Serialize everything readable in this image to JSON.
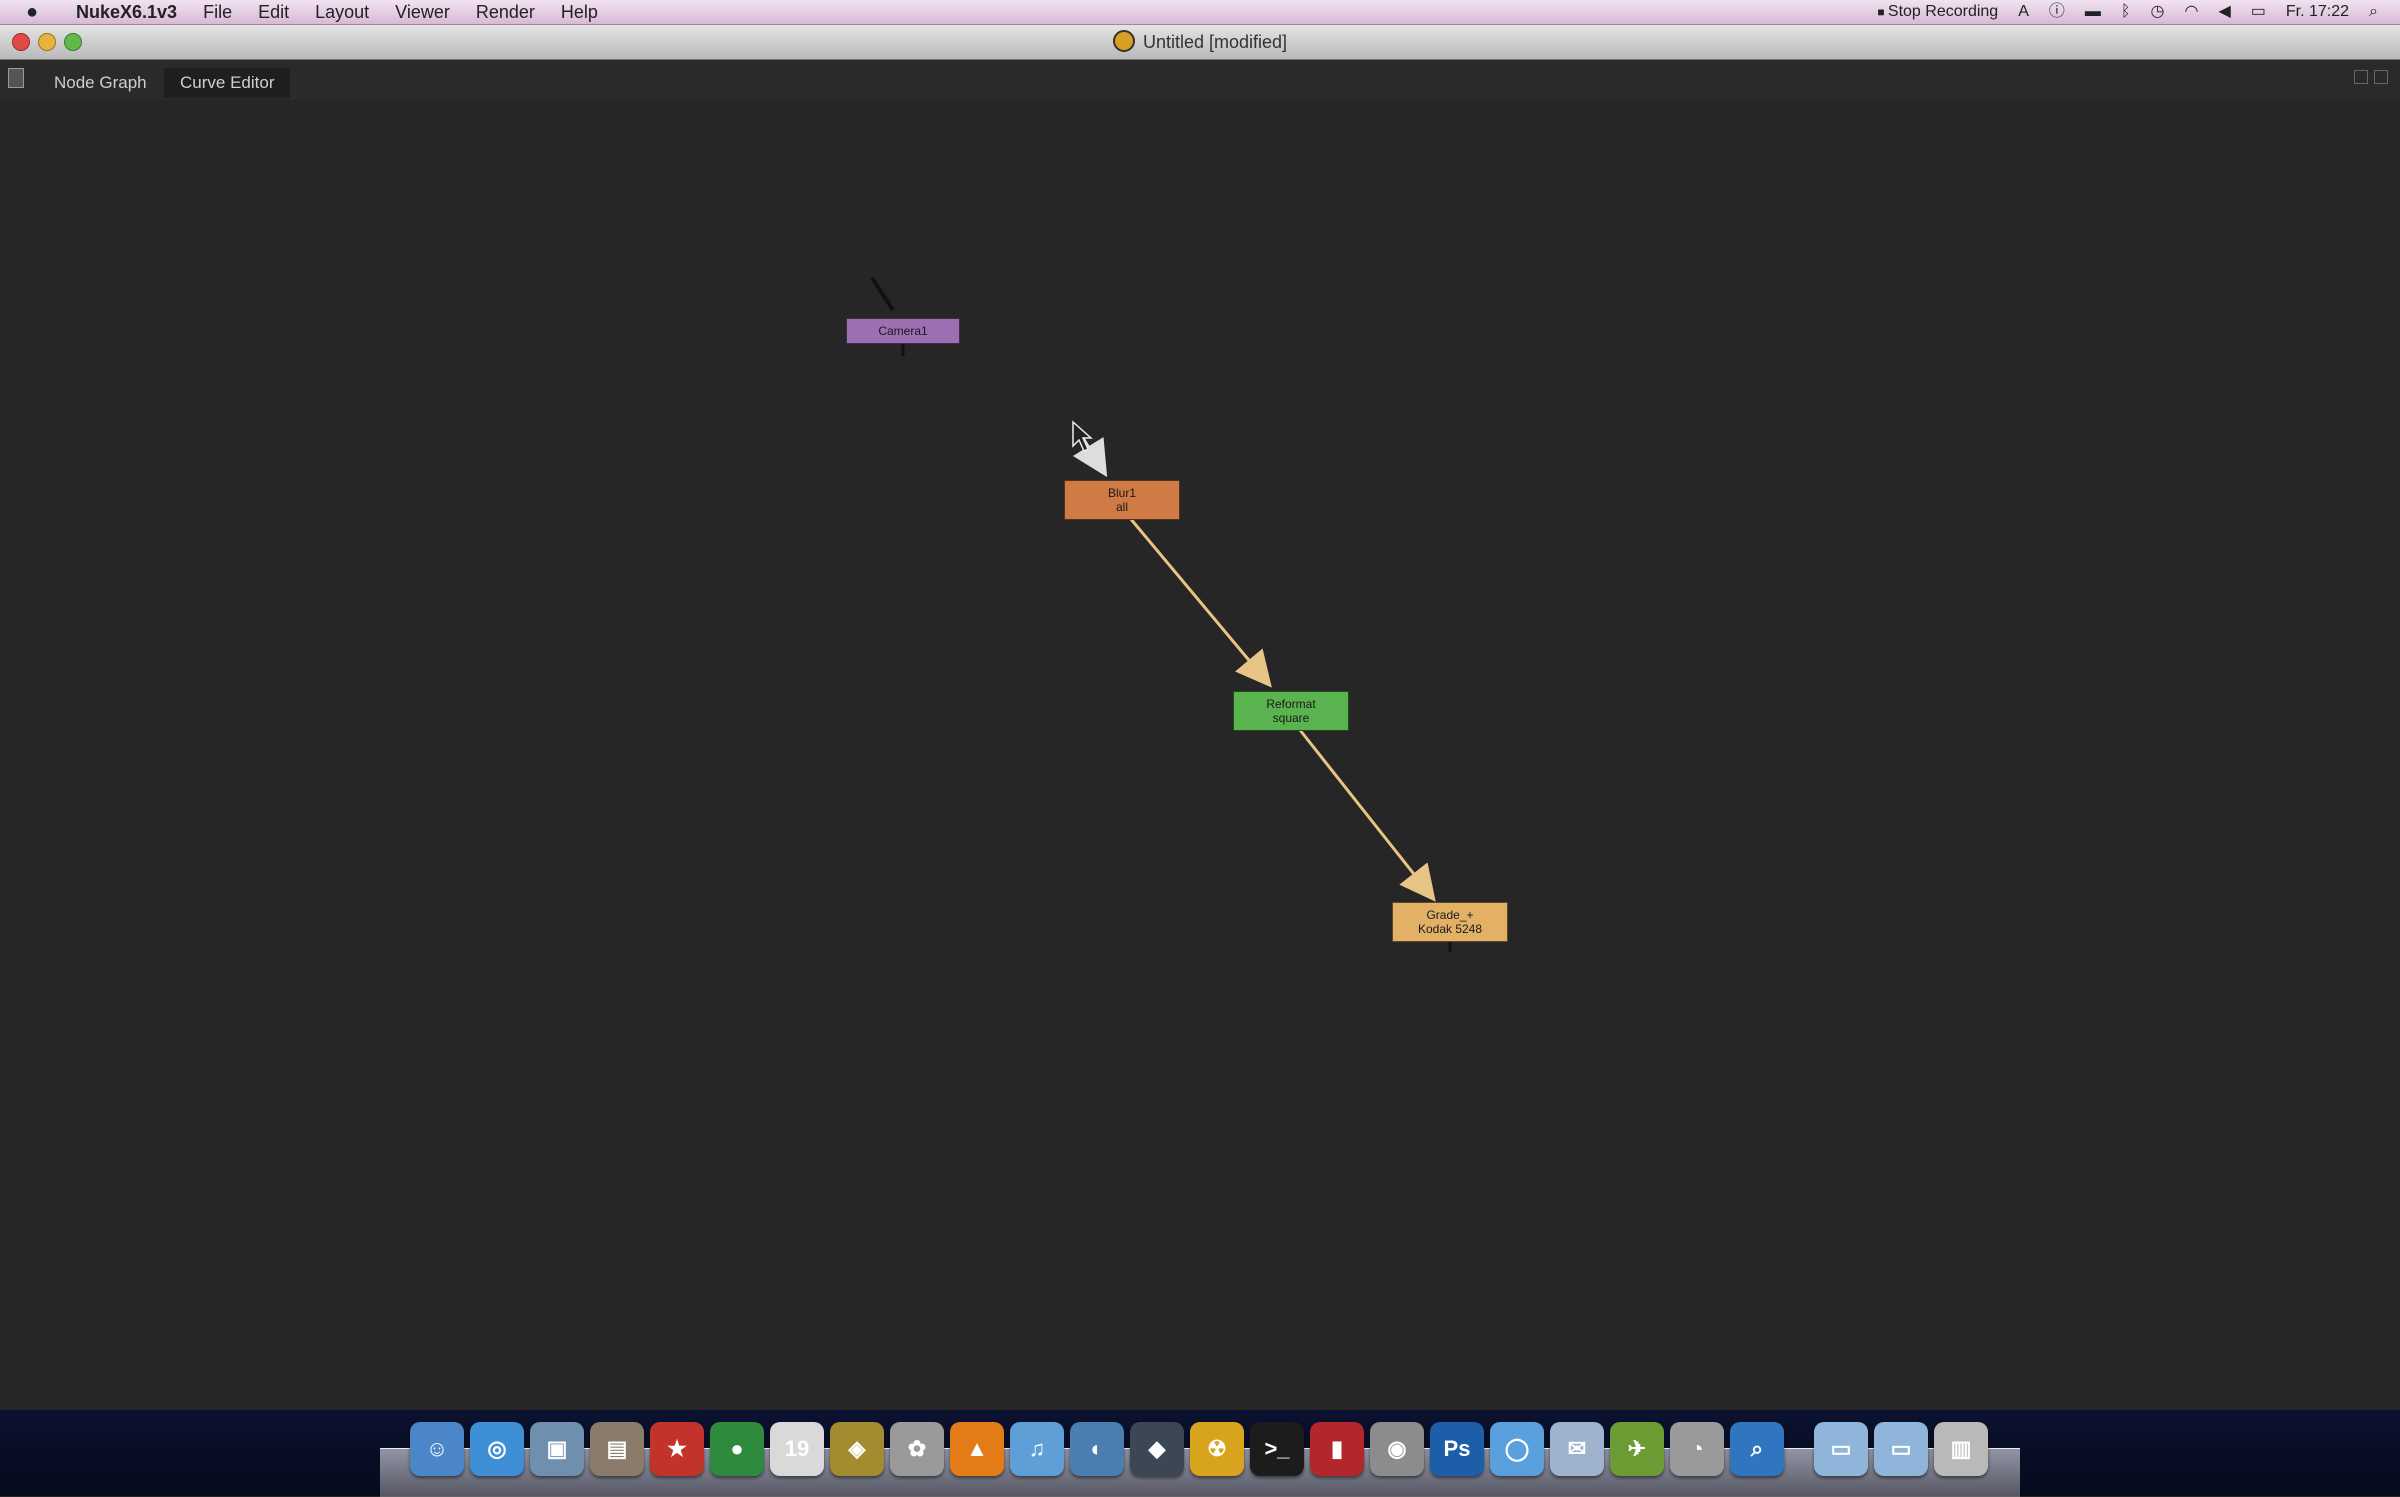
{
  "menubar": {
    "apple": "",
    "app_name": "NukeX6.1v3",
    "menus": [
      "File",
      "Edit",
      "Layout",
      "Viewer",
      "Render",
      "Help"
    ],
    "status": {
      "recording": "Stop Recording",
      "clock": "Fr. 17:22"
    }
  },
  "window": {
    "title": "Untitled [modified]"
  },
  "tabs": [
    {
      "label": "Node Graph",
      "active": false
    },
    {
      "label": "Curve Editor",
      "active": true
    }
  ],
  "nodes": [
    {
      "id": "camera",
      "line1": "Camera1",
      "line2": "",
      "color": "#9b6fb2"
    },
    {
      "id": "blur",
      "line1": "Blur1",
      "line2": "all",
      "color": "#d07a45"
    },
    {
      "id": "reformat",
      "line1": "Reformat",
      "line2": "square",
      "color": "#59b34f"
    },
    {
      "id": "grade",
      "line1": "Grade_+",
      "line2": "Kodak 5248",
      "color": "#e2b166"
    }
  ],
  "colors": {
    "pipe": "#e8c486",
    "graph_bg": "#262626"
  },
  "dock": {
    "icons": [
      {
        "name": "finder-icon",
        "glyph": "☺",
        "color": "#4a86c8"
      },
      {
        "name": "safari-icon",
        "glyph": "◎",
        "color": "#3f8fd6"
      },
      {
        "name": "preview-icon",
        "glyph": "▣",
        "color": "#6f8fae"
      },
      {
        "name": "notes-icon",
        "glyph": "▤",
        "color": "#8a7b6a"
      },
      {
        "name": "game-icon",
        "glyph": "★",
        "color": "#c2332c"
      },
      {
        "name": "globe-icon",
        "glyph": "●",
        "color": "#2e8b3e"
      },
      {
        "name": "calendar-icon",
        "glyph": "19",
        "color": "#d9d9d9"
      },
      {
        "name": "app-icon",
        "glyph": "◈",
        "color": "#a38b2f"
      },
      {
        "name": "photos-icon",
        "glyph": "✿",
        "color": "#9a9a9a"
      },
      {
        "name": "vlc-icon",
        "glyph": "▲",
        "color": "#e37b16"
      },
      {
        "name": "itunes-icon",
        "glyph": "♫",
        "color": "#5e9fd8"
      },
      {
        "name": "app2-icon",
        "glyph": "◐",
        "color": "#4b7db1"
      },
      {
        "name": "app3-icon",
        "glyph": "◆",
        "color": "#3c4754"
      },
      {
        "name": "nuke-icon",
        "glyph": "☢",
        "color": "#d8a41e"
      },
      {
        "name": "terminal-icon",
        "glyph": ">_",
        "color": "#1c1c1c"
      },
      {
        "name": "app4-icon",
        "glyph": "▮",
        "color": "#b3262b"
      },
      {
        "name": "screen-icon",
        "glyph": "◉",
        "color": "#8c8c8c"
      },
      {
        "name": "photoshop-icon",
        "glyph": "Ps",
        "color": "#1d5ea8"
      },
      {
        "name": "chat-icon",
        "glyph": "◯",
        "color": "#5aa0dc"
      },
      {
        "name": "mail-icon",
        "glyph": "✉",
        "color": "#9fb3cc"
      },
      {
        "name": "app5-icon",
        "glyph": "✈",
        "color": "#6e9c34"
      },
      {
        "name": "disk-icon",
        "glyph": "◔",
        "color": "#9a9a9a"
      },
      {
        "name": "search-app-icon",
        "glyph": "⌕",
        "color": "#2f75c0"
      },
      {
        "name": "folder-icon",
        "glyph": "▭",
        "color": "#8fb6da"
      },
      {
        "name": "folder2-icon",
        "glyph": "▭",
        "color": "#8fb6da"
      },
      {
        "name": "trash-icon",
        "glyph": "▥",
        "color": "#b9b9b9"
      }
    ]
  }
}
